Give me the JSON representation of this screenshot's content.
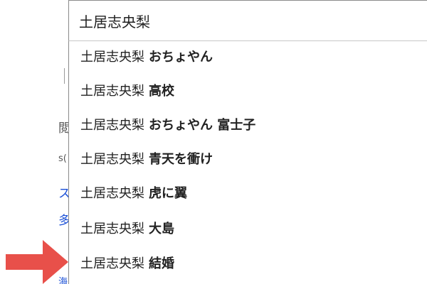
{
  "search": {
    "value": "土居志央梨"
  },
  "suggestions": [
    {
      "base": "土居志央梨",
      "rest": "おちょやん"
    },
    {
      "base": "土居志央梨",
      "rest": "高校"
    },
    {
      "base": "土居志央梨",
      "rest": "おちょやん 富士子"
    },
    {
      "base": "土居志央梨",
      "rest": "青天を衝け"
    },
    {
      "base": "土居志央梨",
      "rest": "虎に翼"
    },
    {
      "base": "土居志央梨",
      "rest": "大島"
    },
    {
      "base": "土居志央梨",
      "rest": "結婚"
    }
  ],
  "colors": {
    "arrow": "#e8504a",
    "link_fragment": "#1a4fd6"
  }
}
